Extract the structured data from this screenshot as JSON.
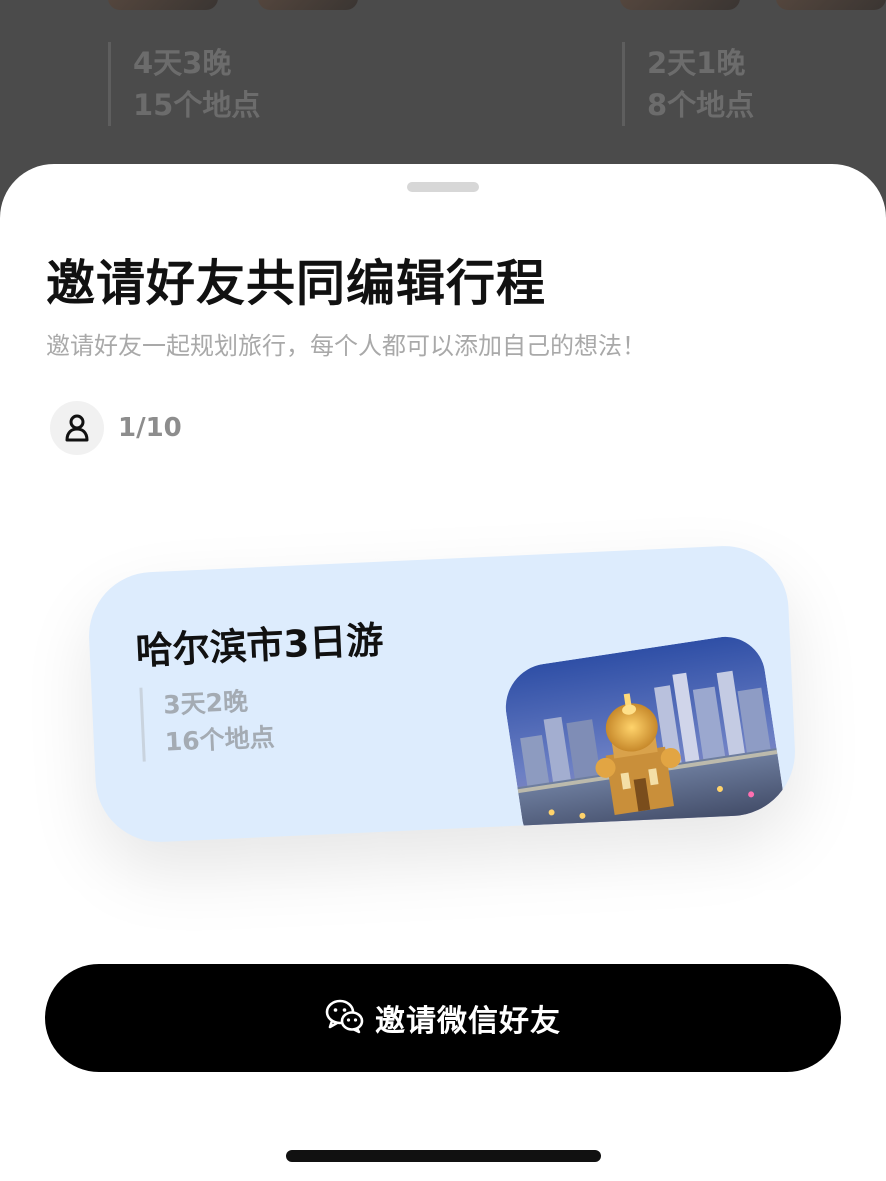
{
  "background": {
    "trips": [
      {
        "duration": "4天3晚",
        "places": "15个地点"
      },
      {
        "duration": "2天1晚",
        "places": "8个地点"
      }
    ]
  },
  "sheet": {
    "title": "邀请好友共同编辑行程",
    "subtitle": "邀请好友一起规划旅行，每个人都可以添加自己的想法！",
    "members": {
      "icon": "person-icon",
      "count": "1/10"
    },
    "trip_card": {
      "title": "哈尔滨市3日游",
      "duration": "3天2晚",
      "places": "16个地点",
      "accent": "#ddecfd"
    },
    "cta": {
      "icon": "wechat-icon",
      "label": "邀请微信好友",
      "color": "#000000"
    }
  }
}
